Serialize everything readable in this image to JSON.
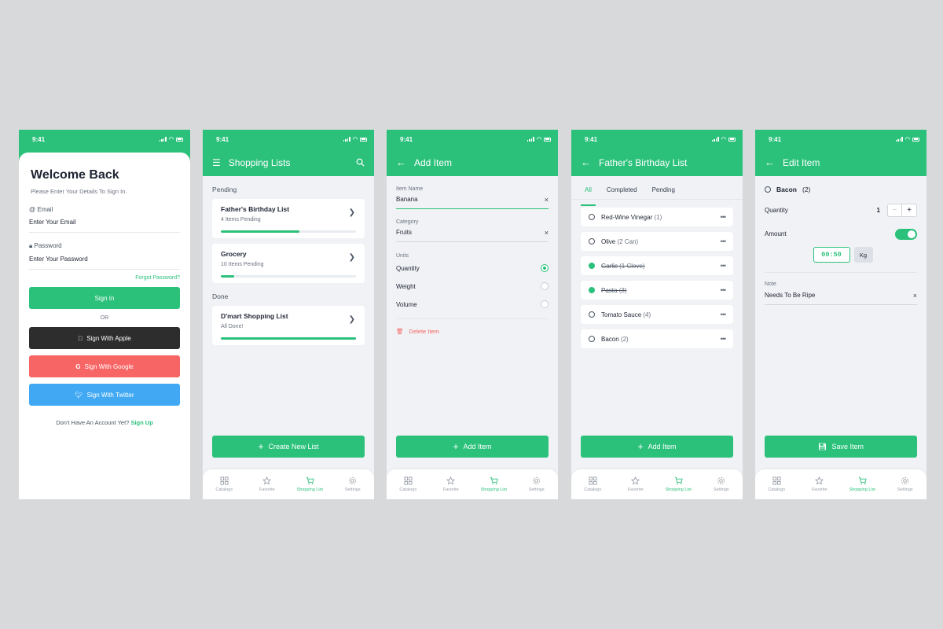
{
  "status_time": "9:41",
  "tabbar": [
    {
      "label": "Catalogs",
      "icon": "grid-icon"
    },
    {
      "label": "Favorite",
      "icon": "star-icon"
    },
    {
      "label": "Shopping List",
      "icon": "cart-icon"
    },
    {
      "label": "Settings",
      "icon": "gear-icon"
    }
  ],
  "accent": "#2bc17b",
  "signin": {
    "title": "Welcome Back",
    "subtitle": "Please Enter Your Details To Sign In.",
    "email_label": "Email",
    "email_placeholder": "Enter Your Email",
    "password_label": "Password",
    "password_placeholder": "Enter Your Password",
    "forgot": "Forgot Password?",
    "signin_button": "Sign In",
    "or": "OR",
    "apple": "Sign With Apple",
    "google": "Sign With Google",
    "twitter": "Sign With Twitter",
    "no_account": "Don't Have An Account Yet?",
    "signup": "Sign Up",
    "colors": {
      "apple": "#2d2d2d",
      "google": "#f76565",
      "twitter": "#41a9f3"
    }
  },
  "lists": {
    "title": "Shopping Lists",
    "pending_label": "Pending",
    "done_label": "Done",
    "pending": [
      {
        "title": "Father's Birthday List",
        "sub": "4 Items Pending",
        "progress": 0.58
      },
      {
        "title": "Grocery",
        "sub": "10 Items Pending",
        "progress": 0.1
      }
    ],
    "done": [
      {
        "title": "D'mart Shopping List",
        "sub": "All Done!",
        "progress": 1.0
      }
    ],
    "create_button": "Create New List"
  },
  "add_item": {
    "title": "Add Item",
    "name_label": "Item Name",
    "name_value": "Banana",
    "category_label": "Category",
    "category_value": "Fruits",
    "units_label": "Units",
    "units": [
      "Quantity",
      "Weight",
      "Volume"
    ],
    "selected_unit": "Quantity",
    "delete": "Delete Item",
    "add_button": "Add Item"
  },
  "birthday": {
    "title": "Father's Birthday List",
    "tabs": [
      "All",
      "Completed",
      "Pending"
    ],
    "active_tab": "All",
    "items": [
      {
        "name": "Red-Wine Vinegar",
        "qty": "(1)",
        "done": false
      },
      {
        "name": "Olive",
        "qty": "(2 Can)",
        "done": false
      },
      {
        "name": "Garlic",
        "qty": "(1 Clove)",
        "done": true
      },
      {
        "name": "Pasta",
        "qty": "(3)",
        "done": true
      },
      {
        "name": "Tomato Sauce",
        "qty": "(4)",
        "done": false
      },
      {
        "name": "Bacon",
        "qty": "(2)",
        "done": false
      }
    ],
    "add_button": "Add Item"
  },
  "edit_item": {
    "title": "Edit Item",
    "item_name": "Bacon",
    "item_qty": "(2)",
    "quantity_label": "Quantity",
    "quantity_value": "1",
    "amount_label": "Amount",
    "amount_on": true,
    "amount_value": "00:50",
    "amount_unit": "Kg",
    "note_label": "Note",
    "note_value": "Needs To Be Ripe",
    "save_button": "Save Item"
  }
}
